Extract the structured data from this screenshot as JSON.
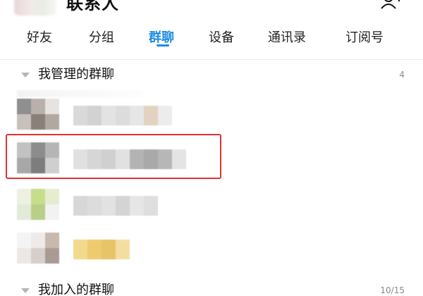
{
  "header": {
    "title": "联系人",
    "add_icon": "add-contact-icon"
  },
  "tabs": [
    {
      "label": "好友",
      "active": false
    },
    {
      "label": "分组",
      "active": false
    },
    {
      "label": "群聊",
      "active": true
    },
    {
      "label": "设备",
      "active": false
    },
    {
      "label": "通讯录",
      "active": false
    },
    {
      "label": "订阅号",
      "active": false
    }
  ],
  "sections": {
    "managed": {
      "title": "我管理的群聊",
      "count": "4"
    },
    "joined": {
      "title": "我加入的群聊",
      "count": "10/15"
    }
  },
  "colors": {
    "accent": "#1d8ce0",
    "highlight_border": "#e23232",
    "section_count": "#8a8a8a"
  },
  "icons": {
    "section_toggle": "triangle-down-icon"
  }
}
